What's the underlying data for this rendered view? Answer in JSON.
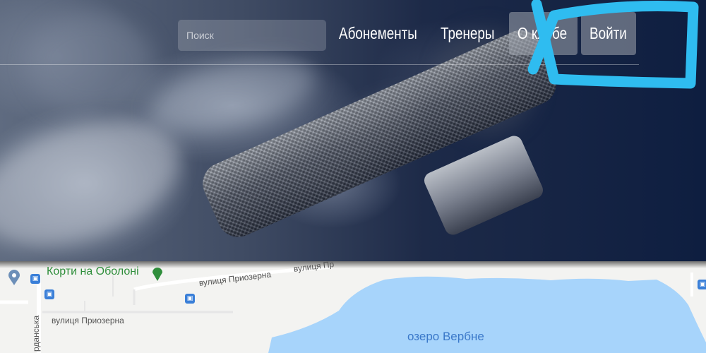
{
  "header": {
    "search_placeholder": "Поиск",
    "nav": {
      "subscriptions": "Абонементы",
      "coaches": "Тренеры",
      "about": "О клубе",
      "login": "Войти"
    }
  },
  "map": {
    "poi_name": "Корти на Оболоні",
    "street_1": "вулиця Приозерна",
    "street_2": "вулиця Приозерна",
    "street_3": "вулиця Пр",
    "street_vertical": "рданська",
    "lake_name": "озеро Вербне"
  },
  "colors": {
    "hero_dark": "#0e1e40",
    "annotation": "#2fbcf0",
    "lake": "#a7d4fb",
    "poi_green": "#2f8e3b"
  }
}
